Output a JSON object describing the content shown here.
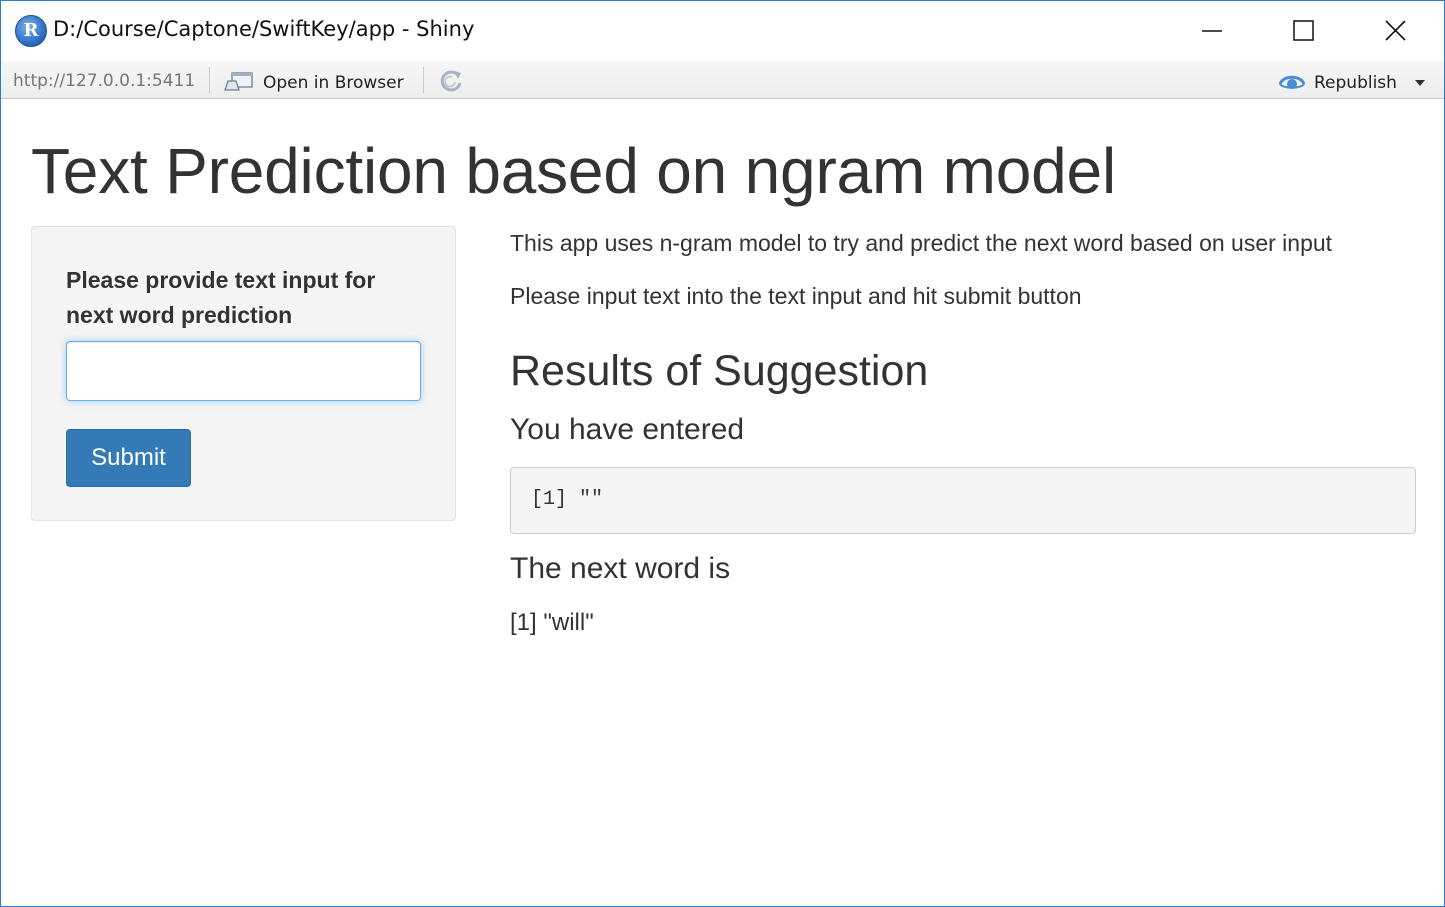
{
  "window": {
    "title": "D:/Course/Captone/SwiftKey/app - Shiny",
    "app_icon_letter": "R"
  },
  "toolbar": {
    "url": "http://127.0.0.1:5411",
    "open_in_browser": "Open in Browser",
    "republish": "Republish"
  },
  "page": {
    "title": "Text Prediction based on ngram model"
  },
  "sidebar": {
    "input_label": "Please provide text input for next word prediction",
    "input_value": "",
    "submit_label": "Submit"
  },
  "main": {
    "description_1": "This app uses n-gram model to try and predict the next word based on user input",
    "description_2": "Please input text into the text input and hit submit button",
    "results_heading": "Results of Suggestion",
    "entered_heading": "You have entered",
    "entered_output": "[1] \"\"",
    "next_word_heading": "The next word is",
    "next_word_output": "[1] \"will\""
  },
  "colors": {
    "accent": "#337ab7",
    "window_border": "#2b7bd1",
    "well_background": "#f5f5f5"
  }
}
